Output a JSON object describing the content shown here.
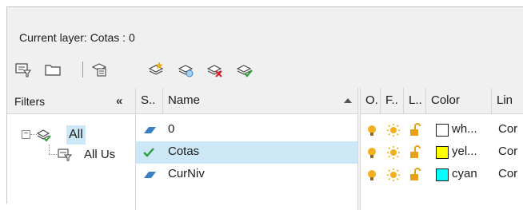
{
  "header": {
    "current_layer_text": "Current layer: Cotas : 0"
  },
  "toolbar": {
    "buttons": [
      {
        "name": "new-property-filter-icon"
      },
      {
        "name": "new-group-filter-icon"
      },
      {
        "name": "layer-states-manager-icon"
      },
      {
        "name": "new-layer-icon"
      },
      {
        "name": "new-layer-vp-frozen-icon"
      },
      {
        "name": "delete-layer-icon"
      },
      {
        "name": "set-current-icon"
      }
    ]
  },
  "filters": {
    "title": "Filters",
    "collapse_label": "«",
    "tree": {
      "root_toggle": "−",
      "root_label": "All",
      "child_label": "All Us"
    }
  },
  "grid": {
    "columns": {
      "status": "S..",
      "name": "Name",
      "on": "O.",
      "freeze": "F..",
      "lock": "L..",
      "color": "Color",
      "linetype": "Lin"
    },
    "rows": [
      {
        "status_icon": "layer-icon",
        "name": "0",
        "on": "on-bulb-icon",
        "freeze": "thawed-sun-icon",
        "lock": "unlocked-icon",
        "swatch_hex": "#ffffff",
        "color": "wh...",
        "linetype": "Cor",
        "selected": false
      },
      {
        "status_icon": "current-checkmark-icon",
        "name": "Cotas",
        "on": "on-bulb-icon",
        "freeze": "thawed-sun-icon",
        "lock": "unlocked-icon",
        "swatch_hex": "#ffff00",
        "color": "yel...",
        "linetype": "Cor",
        "selected": true
      },
      {
        "status_icon": "layer-icon",
        "name": "CurNiv",
        "on": "on-bulb-icon",
        "freeze": "thawed-sun-icon",
        "lock": "unlocked-icon",
        "swatch_hex": "#00ffff",
        "color": "cyan",
        "linetype": "Cor",
        "selected": false
      }
    ]
  },
  "colors": {
    "selection": "#cce8f7",
    "checkmark": "#2e9d3a",
    "layer_icon": "#3b7fc4",
    "bulb": "#f2b01e",
    "lock": "#e6a21a"
  }
}
